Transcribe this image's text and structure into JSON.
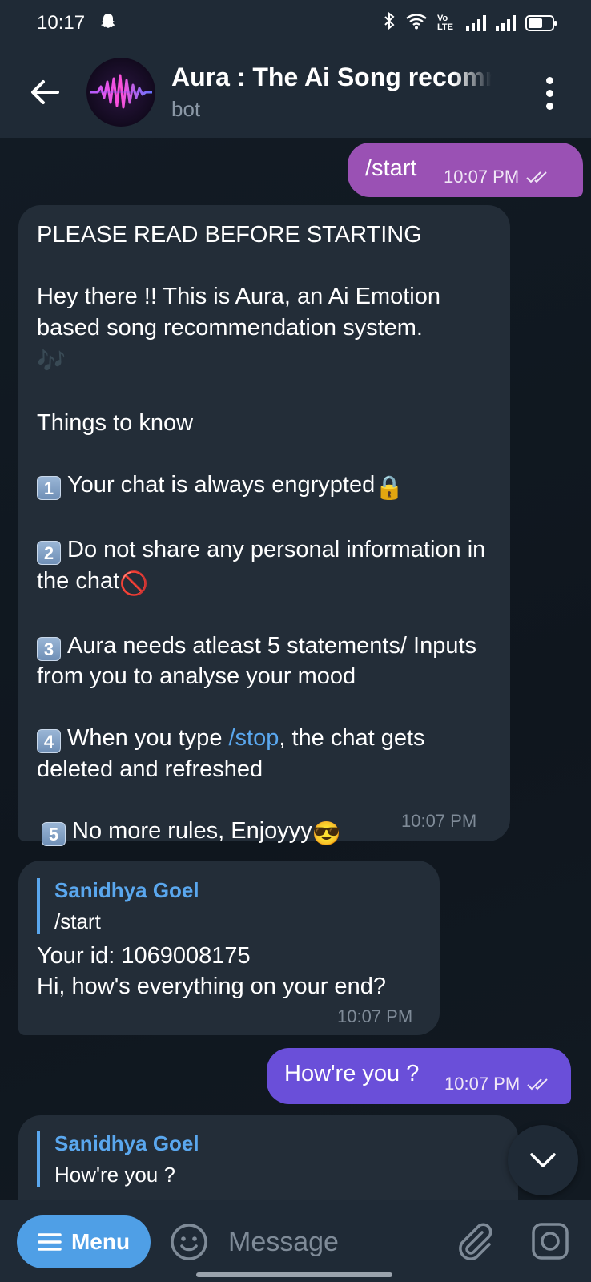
{
  "status_bar": {
    "time": "10:17",
    "network_label": "Vo LTE"
  },
  "header": {
    "title": "Aura : The Ai Song recommendation system",
    "subtitle": "bot"
  },
  "messages": {
    "start": {
      "text": "/start",
      "time": "10:07 PM"
    },
    "rules": {
      "heading": "PLEASE READ BEFORE STARTING",
      "intro": "Hey there !! This is Aura, an Ai Emotion based song recommendation system.",
      "intro_emoji": "🎶",
      "things": "Things to know",
      "rule1_num": "1",
      "rule1": "Your chat is always engrypted",
      "rule1_emoji": "🔒",
      "rule2_num": "2",
      "rule2": "Do not share any personal information in the chat",
      "rule2_emoji": "🚫",
      "rule3_num": "3",
      "rule3": "Aura needs atleast 5 statements/ Inputs from you to analyse your mood",
      "rule4_num": "4",
      "rule4_pre": "When you type ",
      "rule4_cmd": "/stop",
      "rule4_post": ", the chat gets deleted and refreshed",
      "rule5_num": "5",
      "rule5": "No more rules, Enjoyyy",
      "rule5_emoji": "😎",
      "time": "10:07 PM"
    },
    "reply1": {
      "quote_name": "Sanidhya Goel",
      "quote_text": "/start",
      "line1": "Your id: 1069008175",
      "line2": "Hi, how's everything on your end?",
      "time": "10:07 PM"
    },
    "howre": {
      "text": "How're you ?",
      "time": "10:07 PM"
    },
    "reply2": {
      "quote_name": "Sanidhya Goel",
      "quote_text": "How're you ?"
    }
  },
  "input_bar": {
    "menu_label": "Menu",
    "placeholder": "Message"
  },
  "colors": {
    "outgoing_purple": "#9a51b4",
    "outgoing_violet": "#6a4fd9",
    "incoming": "#232d38",
    "accent_blue": "#5aa7ee"
  }
}
